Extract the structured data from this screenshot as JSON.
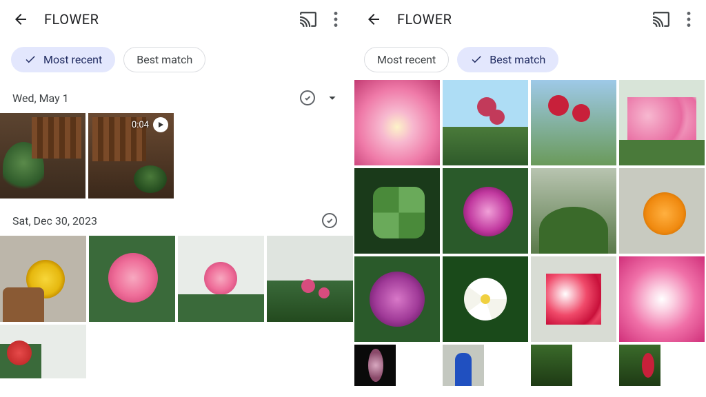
{
  "left": {
    "title": "FLOWER",
    "chips": {
      "mostRecent": {
        "label": "Most recent",
        "selected": true
      },
      "bestMatch": {
        "label": "Best match",
        "selected": false
      }
    },
    "sections": [
      {
        "date": "Wed, May 1",
        "expandable": true,
        "items": [
          {
            "kind": "photo",
            "colors": {
              "bg": "#6a4a36"
            }
          },
          {
            "kind": "video",
            "duration": "0:04",
            "colors": {
              "bg": "#5e4534"
            }
          }
        ]
      },
      {
        "date": "Sat, Dec 30, 2023",
        "expandable": false,
        "items": [
          {
            "kind": "photo",
            "flower": "yellow-dahlia"
          },
          {
            "kind": "photo",
            "flower": "pink-rose"
          },
          {
            "kind": "photo",
            "flower": "pink-rose-small"
          },
          {
            "kind": "photo",
            "flower": "rose-bush"
          },
          {
            "kind": "photo",
            "flower": "partial"
          }
        ]
      }
    ]
  },
  "right": {
    "title": "FLOWER",
    "chips": {
      "mostRecent": {
        "label": "Most recent",
        "selected": false
      },
      "bestMatch": {
        "label": "Best match",
        "selected": true
      }
    },
    "grid": [
      {
        "flower": "pink-macro"
      },
      {
        "flower": "red-tall"
      },
      {
        "flower": "red-cluster"
      },
      {
        "flower": "adenium-pink"
      },
      {
        "flower": "green-leaf-clover"
      },
      {
        "flower": "magenta-aster"
      },
      {
        "flower": "garden-green"
      },
      {
        "flower": "orange-zinnia"
      },
      {
        "flower": "purple-aster"
      },
      {
        "flower": "plumeria-white"
      },
      {
        "flower": "adenium-red"
      },
      {
        "flower": "adenium-pink-macro"
      },
      {
        "flower": "dark-bloom"
      },
      {
        "flower": "blue-pot"
      },
      {
        "flower": "green-foliage"
      },
      {
        "flower": "green-red"
      }
    ]
  }
}
